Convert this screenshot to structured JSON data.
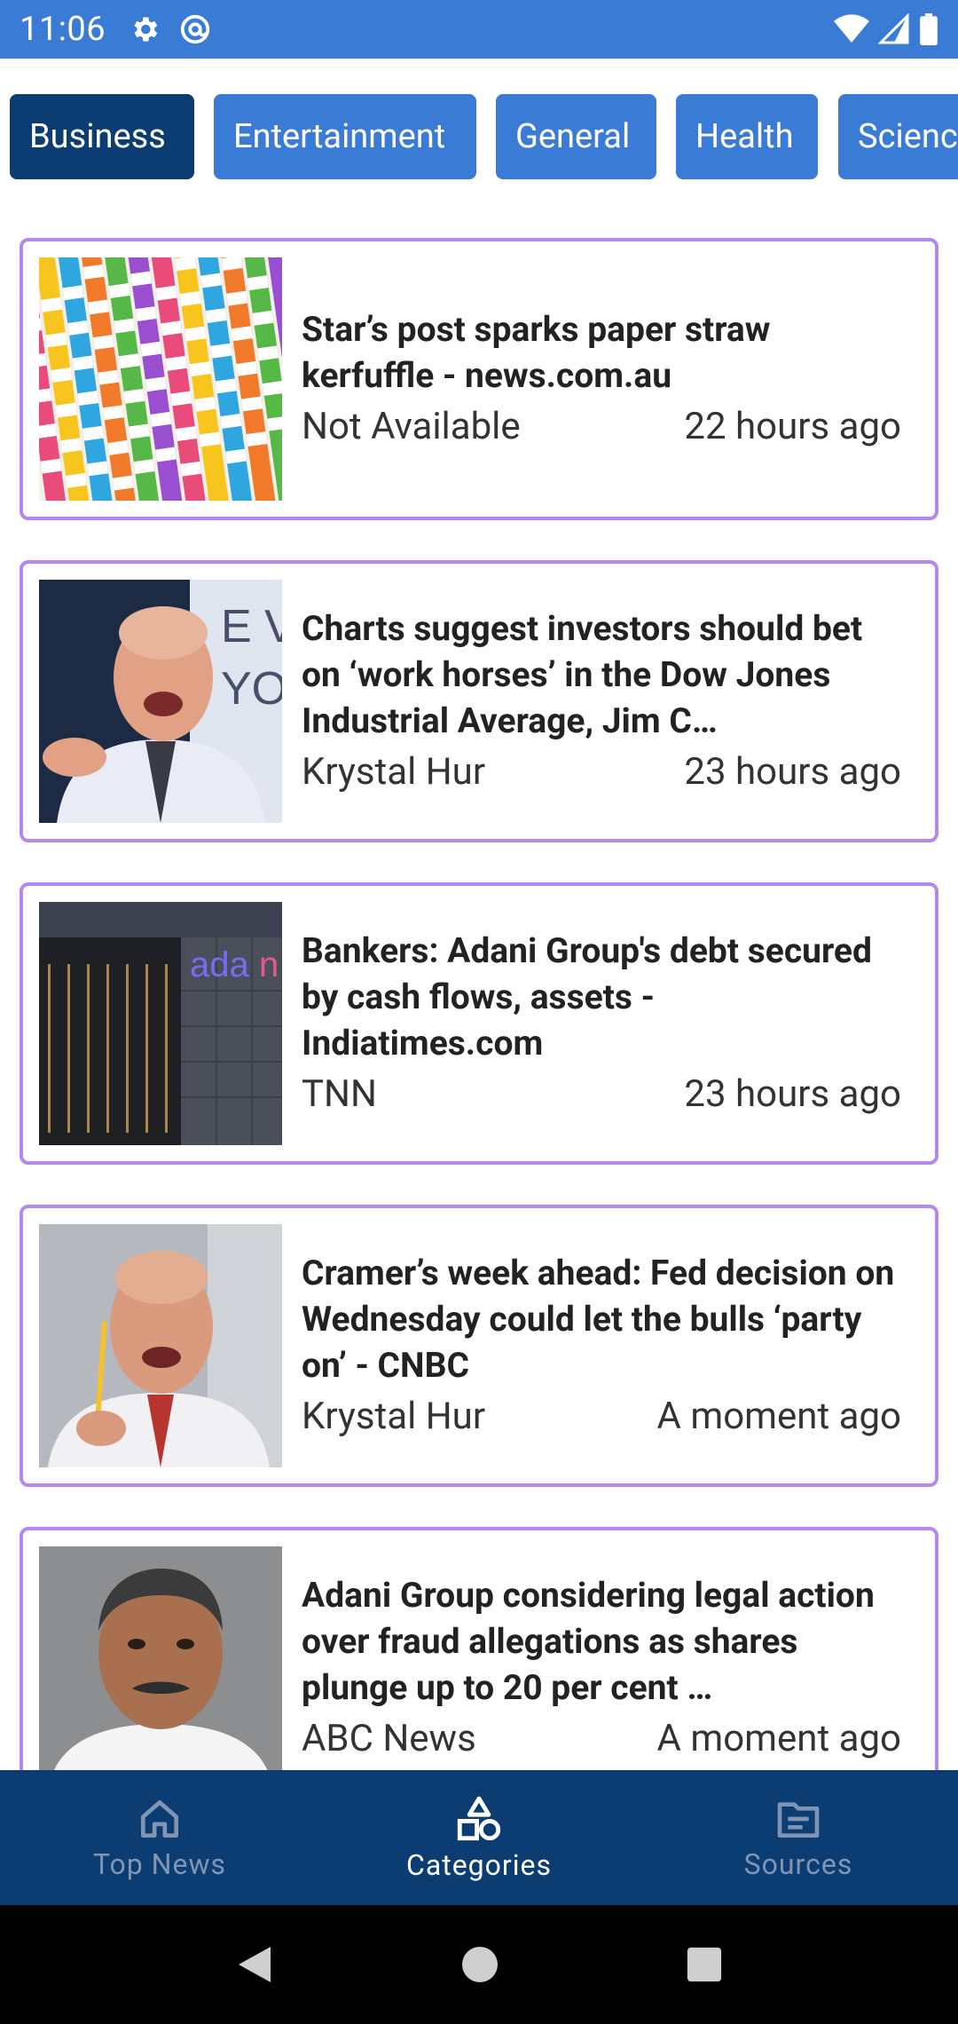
{
  "status_bar": {
    "time": "11:06"
  },
  "categories": [
    {
      "label": "Business",
      "active": true
    },
    {
      "label": "Entertainment",
      "active": false
    },
    {
      "label": "General",
      "active": false
    },
    {
      "label": "Health",
      "active": false
    },
    {
      "label": "Science",
      "active": false
    }
  ],
  "articles": [
    {
      "title": "Star’s post sparks paper straw kerfuffle - news.com.au",
      "author": "Not Available",
      "time": "22 hours ago",
      "image": "colorful-paper-straws"
    },
    {
      "title": "Charts suggest investors should bet on ‘work horses’ in the Dow Jones Industrial Average, Jim C…",
      "author": "Krystal Hur",
      "time": "23 hours ago",
      "image": "jim-cramer-portrait"
    },
    {
      "title": "Bankers: Adani Group's debt secured by cash flows, assets - Indiatimes.com",
      "author": "TNN",
      "time": "23 hours ago",
      "image": "adani-building"
    },
    {
      "title": "Cramer’s week ahead: Fed decision on Wednesday could let the bulls ‘party on’ - CNBC",
      "author": "Krystal Hur",
      "time": "A moment ago",
      "image": "jim-cramer-pencil"
    },
    {
      "title": "Adani Group considering legal action over fraud allegations as shares plunge up to 20 per cent …",
      "author": "ABC News",
      "time": "A moment ago",
      "image": "gautam-adani-portrait"
    }
  ],
  "bottom_nav": [
    {
      "label": "Top News",
      "icon": "home-icon",
      "active": false
    },
    {
      "label": "Categories",
      "icon": "shapes-icon",
      "active": true
    },
    {
      "label": "Sources",
      "icon": "folder-icon",
      "active": false
    }
  ],
  "colors": {
    "primary": "#3a7bd5",
    "primary_dark": "#0b3d72",
    "card_border": "#b388f0"
  }
}
